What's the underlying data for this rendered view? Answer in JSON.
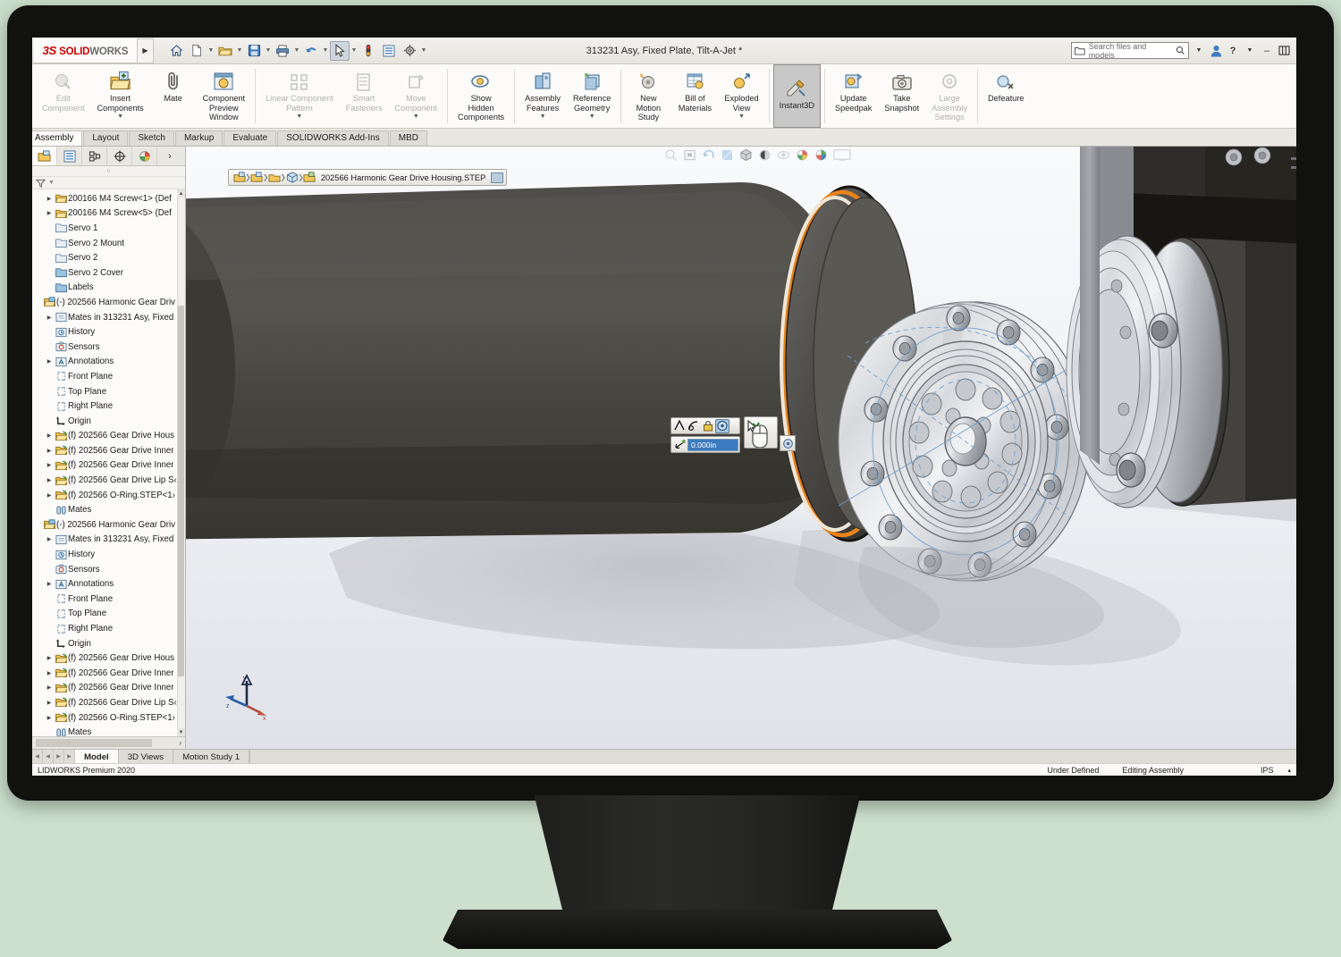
{
  "app": {
    "brand": "SOLIDWORKS",
    "brand_prefix": "3S",
    "title": "313231 Asy, Fixed Plate, Tilt-A-Jet *",
    "version_status": "LIDWORKS Premium 2020"
  },
  "titlebar": {
    "quick_access": [
      {
        "name": "home-icon",
        "glyph": "⌂"
      },
      {
        "name": "new-document-icon",
        "glyph": "⬚"
      },
      {
        "name": "open-folder-icon",
        "glyph": "Ὄ1"
      },
      {
        "name": "save-icon",
        "glyph": "▣"
      },
      {
        "name": "print-icon",
        "glyph": "⎙"
      },
      {
        "name": "undo-icon",
        "glyph": "↶"
      },
      {
        "name": "select-cursor-icon",
        "glyph": "➤"
      },
      {
        "name": "rebuild-icon",
        "glyph": "⬤"
      },
      {
        "name": "options-list-icon",
        "glyph": "☰"
      },
      {
        "name": "gear-icon",
        "glyph": "⚙"
      }
    ],
    "search": {
      "placeholder": "Search files and models",
      "value": ""
    },
    "right_icons": [
      {
        "name": "user-account-icon",
        "glyph": "⚹"
      },
      {
        "name": "help-icon",
        "glyph": "?"
      },
      {
        "name": "minimize-icon",
        "glyph": "–"
      },
      {
        "name": "restore-icon",
        "glyph": "⧉"
      }
    ]
  },
  "ribbon": {
    "items": [
      {
        "label": "Edit\nComponent",
        "name": "edit-component",
        "state": "disabled",
        "caret": false
      },
      {
        "label": "Insert\nComponents",
        "name": "insert-components",
        "state": "enabled",
        "caret": true
      },
      {
        "label": "Mate",
        "name": "mate",
        "state": "enabled",
        "caret": false
      },
      {
        "label": "Component\nPreview\nWindow",
        "name": "component-preview-window",
        "state": "enabled",
        "caret": false
      },
      {
        "label": "Linear Component\nPattern",
        "name": "linear-component-pattern",
        "state": "disabled",
        "caret": true
      },
      {
        "label": "Smart\nFasteners",
        "name": "smart-fasteners",
        "state": "disabled",
        "caret": false
      },
      {
        "label": "Move\nComponent",
        "name": "move-component",
        "state": "disabled",
        "caret": true
      },
      {
        "label": "Show\nHidden\nComponents",
        "name": "show-hidden-components",
        "state": "enabled",
        "caret": false
      },
      {
        "label": "Assembly\nFeatures",
        "name": "assembly-features",
        "state": "enabled",
        "caret": true
      },
      {
        "label": "Reference\nGeometry",
        "name": "reference-geometry",
        "state": "enabled",
        "caret": true
      },
      {
        "label": "New\nMotion\nStudy",
        "name": "new-motion-study",
        "state": "enabled",
        "caret": false
      },
      {
        "label": "Bill of\nMaterials",
        "name": "bill-of-materials",
        "state": "enabled",
        "caret": false
      },
      {
        "label": "Exploded\nView",
        "name": "exploded-view",
        "state": "enabled",
        "caret": true
      },
      {
        "label": "Instant3D",
        "name": "instant3d",
        "state": "active",
        "caret": false
      },
      {
        "label": "Update\nSpeedpak",
        "name": "update-speedpak",
        "state": "enabled",
        "caret": false
      },
      {
        "label": "Take\nSnapshot",
        "name": "take-snapshot",
        "state": "enabled",
        "caret": false
      },
      {
        "label": "Large\nAssembly\nSettings",
        "name": "large-assembly-settings",
        "state": "disabled",
        "caret": false
      },
      {
        "label": "Defeature",
        "name": "defeature",
        "state": "enabled",
        "caret": false
      }
    ]
  },
  "command_tabs": [
    {
      "label": "Assembly",
      "name": "tab-assembly",
      "active": true
    },
    {
      "label": "Layout",
      "name": "tab-layout",
      "active": false
    },
    {
      "label": "Sketch",
      "name": "tab-sketch",
      "active": false
    },
    {
      "label": "Markup",
      "name": "tab-markup",
      "active": false
    },
    {
      "label": "Evaluate",
      "name": "tab-evaluate",
      "active": false
    },
    {
      "label": "SOLIDWORKS Add-Ins",
      "name": "tab-solidworks-add-ins",
      "active": false
    },
    {
      "label": "MBD",
      "name": "tab-mbd",
      "active": false
    }
  ],
  "left_panel": {
    "icon_tabs": [
      {
        "name": "feature-manager-tree-icon",
        "glyph": "⚘",
        "active": true
      },
      {
        "name": "property-manager-icon",
        "glyph": "≡",
        "active": false
      },
      {
        "name": "configuration-manager-icon",
        "glyph": "⊞",
        "active": false
      },
      {
        "name": "dimxpert-manager-icon",
        "glyph": "⊕",
        "active": false
      },
      {
        "name": "display-manager-icon",
        "glyph": "◕",
        "active": false
      },
      {
        "name": "expand-panel-chevron-icon",
        "glyph": "›",
        "active": false
      }
    ],
    "filter_placeholder": "",
    "tree": [
      {
        "indent": 1,
        "twisty": true,
        "icon": "component",
        "label": "200166 M4 Screw<1>  (Def"
      },
      {
        "indent": 1,
        "twisty": true,
        "icon": "component",
        "label": "200166 M4 Screw<5>  (Def"
      },
      {
        "indent": 1,
        "twisty": false,
        "icon": "folder",
        "label": "Servo 1"
      },
      {
        "indent": 1,
        "twisty": false,
        "icon": "folder",
        "label": "Servo 2 Mount"
      },
      {
        "indent": 1,
        "twisty": false,
        "icon": "folder",
        "label": "Servo 2"
      },
      {
        "indent": 1,
        "twisty": false,
        "icon": "folder-d",
        "label": "Servo 2 Cover"
      },
      {
        "indent": 1,
        "twisty": false,
        "icon": "folder-d",
        "label": "Labels"
      },
      {
        "indent": 0,
        "twisty": false,
        "icon": "assembly",
        "label": "(-) 202566 Harmonic Gear Driv"
      },
      {
        "indent": 1,
        "twisty": true,
        "icon": "mates-in",
        "label": "Mates in 313231 Asy, Fixed"
      },
      {
        "indent": 1,
        "twisty": false,
        "icon": "history",
        "label": "History"
      },
      {
        "indent": 1,
        "twisty": false,
        "icon": "sensors",
        "label": "Sensors"
      },
      {
        "indent": 1,
        "twisty": true,
        "icon": "annot",
        "label": "Annotations"
      },
      {
        "indent": 1,
        "twisty": false,
        "icon": "plane",
        "label": "Front Plane"
      },
      {
        "indent": 1,
        "twisty": false,
        "icon": "plane",
        "label": "Top Plane"
      },
      {
        "indent": 1,
        "twisty": false,
        "icon": "plane",
        "label": "Right Plane"
      },
      {
        "indent": 1,
        "twisty": false,
        "icon": "origin",
        "label": "Origin"
      },
      {
        "indent": 1,
        "twisty": true,
        "icon": "part",
        "label": "(f) 202566 Gear Drive Hous"
      },
      {
        "indent": 1,
        "twisty": true,
        "icon": "part",
        "label": "(f) 202566 Gear Drive Inner"
      },
      {
        "indent": 1,
        "twisty": true,
        "icon": "part",
        "label": "(f) 202566 Gear Drive Inner"
      },
      {
        "indent": 1,
        "twisty": true,
        "icon": "part",
        "label": "(f) 202566 Gear Drive Lip S‹"
      },
      {
        "indent": 1,
        "twisty": true,
        "icon": "part",
        "label": "(f) 202566 O-Ring.STEP<1›"
      },
      {
        "indent": 1,
        "twisty": false,
        "icon": "mates",
        "label": "Mates"
      },
      {
        "indent": 0,
        "twisty": false,
        "icon": "assembly",
        "label": "(-) 202566 Harmonic Gear Driv"
      },
      {
        "indent": 1,
        "twisty": true,
        "icon": "mates-in",
        "label": "Mates in 313231 Asy, Fixed"
      },
      {
        "indent": 1,
        "twisty": false,
        "icon": "history",
        "label": "History"
      },
      {
        "indent": 1,
        "twisty": false,
        "icon": "sensors",
        "label": "Sensors"
      },
      {
        "indent": 1,
        "twisty": true,
        "icon": "annot",
        "label": "Annotations"
      },
      {
        "indent": 1,
        "twisty": false,
        "icon": "plane",
        "label": "Front Plane"
      },
      {
        "indent": 1,
        "twisty": false,
        "icon": "plane",
        "label": "Top Plane"
      },
      {
        "indent": 1,
        "twisty": false,
        "icon": "plane",
        "label": "Right Plane"
      },
      {
        "indent": 1,
        "twisty": false,
        "icon": "origin",
        "label": "Origin"
      },
      {
        "indent": 1,
        "twisty": true,
        "icon": "part",
        "label": "(f) 202566 Gear Drive Hous"
      },
      {
        "indent": 1,
        "twisty": true,
        "icon": "part",
        "label": "(f) 202566 Gear Drive Inner"
      },
      {
        "indent": 1,
        "twisty": true,
        "icon": "part",
        "label": "(f) 202566 Gear Drive Inner"
      },
      {
        "indent": 1,
        "twisty": true,
        "icon": "part",
        "label": "(f) 202566 Gear Drive Lip S‹"
      },
      {
        "indent": 1,
        "twisty": true,
        "icon": "part",
        "label": "(f) 202566 O-Ring.STEP<1›"
      },
      {
        "indent": 1,
        "twisty": false,
        "icon": "mates",
        "label": "Mates"
      }
    ]
  },
  "viewport": {
    "breadcrumb": {
      "label": "202566 Harmonic Gear Drive Housing.STEP",
      "icons": [
        {
          "name": "breadcrumb-assembly-icon"
        },
        {
          "name": "breadcrumb-assembly-icon"
        },
        {
          "name": "breadcrumb-subassembly-icon"
        },
        {
          "name": "breadcrumb-part-icon"
        },
        {
          "name": "breadcrumb-face-icon"
        }
      ]
    },
    "view_toolbar": [
      {
        "name": "zoom-to-fit-icon",
        "glyph": "⌕"
      },
      {
        "name": "zoom-to-area-icon",
        "glyph": "▣"
      },
      {
        "name": "previous-view-icon",
        "glyph": "↺"
      },
      {
        "name": "section-view-icon",
        "glyph": "◧"
      },
      {
        "name": "view-orientation-icon",
        "glyph": "⬚"
      },
      {
        "name": "display-style-icon",
        "glyph": "◐"
      },
      {
        "name": "hide-show-items-icon",
        "glyph": "◉"
      },
      {
        "name": "edit-appearance-icon",
        "glyph": "●"
      },
      {
        "name": "apply-scene-icon",
        "glyph": "⬤"
      },
      {
        "name": "view-settings-icon",
        "glyph": "⬜"
      }
    ],
    "popup_toolbar": {
      "buttons": [
        {
          "name": "dimension-angle-icon",
          "glyph": "∠",
          "selected": false
        },
        {
          "name": "dimension-arc-icon",
          "glyph": "⌒",
          "selected": false
        },
        {
          "name": "lock-dimension-icon",
          "glyph": "▤",
          "selected": false
        },
        {
          "name": "instant3d-move-icon",
          "glyph": "◉",
          "selected": true
        },
        {
          "name": "confirm-check-icon",
          "glyph": "✓",
          "selected": false
        }
      ],
      "value_field": {
        "name": "instant3d-distance-input",
        "value": "0.000in",
        "selected": true
      },
      "extra_button": {
        "name": "instant3d-options-icon",
        "glyph": "◉"
      }
    },
    "triad": {
      "x_label": "x",
      "y_label": "y",
      "z_label": "z"
    }
  },
  "bottom_tabs": [
    {
      "label": "Model",
      "name": "bottom-tab-model",
      "active": true
    },
    {
      "label": "3D Views",
      "name": "bottom-tab-3d-views",
      "active": false
    },
    {
      "label": "Motion Study 1",
      "name": "bottom-tab-motion-study-1",
      "active": false
    }
  ],
  "status_bar": {
    "left": "LIDWORKS Premium 2020",
    "under_defined": "Under Defined",
    "editing": "Editing Assembly",
    "units": "IPS",
    "expand_glyph": "▴"
  },
  "colors": {
    "accent_blue": "#3d7bbf",
    "brand_red": "#cc0000",
    "highlight_orange": "#e8841a",
    "ribbon_bg": "#fcfbf9",
    "chrome_bg": "#e9e7e1",
    "screen_bg": "#eceae4",
    "page_bg": "#cde0cd",
    "model_dark": "#4a4845",
    "model_steel": "#b8bcc0"
  }
}
